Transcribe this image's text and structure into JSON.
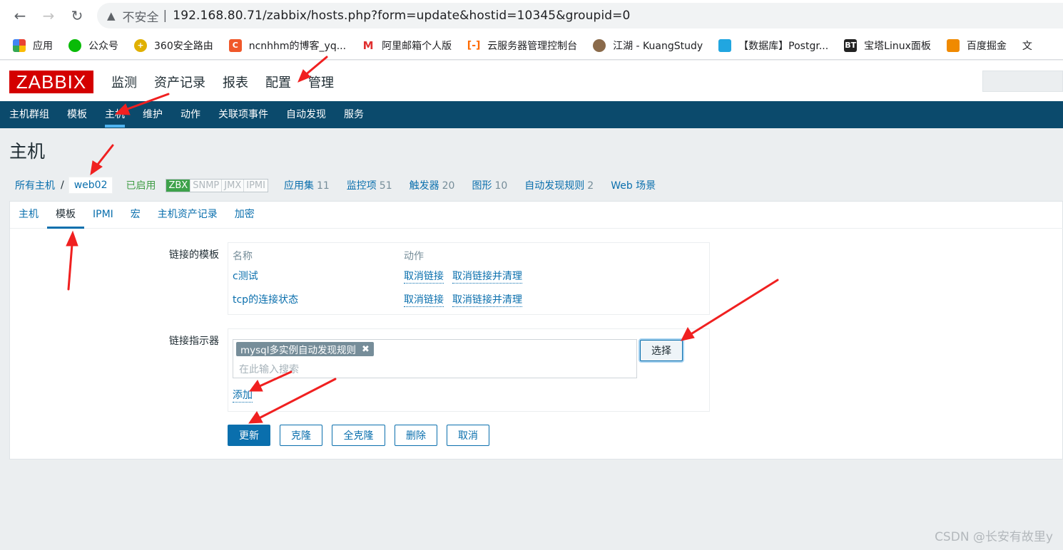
{
  "browser": {
    "insecure_label": "不安全",
    "separator": "|",
    "url": "192.168.80.71/zabbix/hosts.php?form=update&hostid=10345&groupid=0",
    "bookmarks": [
      {
        "label": "应用",
        "color": "#e94235"
      },
      {
        "label": "公众号",
        "color": "#09bb07"
      },
      {
        "label": "360安全路由",
        "color": "#e0b000"
      },
      {
        "label": "ncnhhm的博客_yq...",
        "color": "#f0582a"
      },
      {
        "label": "阿里邮箱个人版",
        "color": "#e03030"
      },
      {
        "label": "云服务器管理控制台",
        "color": "#ff6a00"
      },
      {
        "label": "江湖 - KuangStudy",
        "color": "#8a6a4a"
      },
      {
        "label": "【数据库】Postgr...",
        "color": "#21a6e0"
      },
      {
        "label": "宝塔Linux面板",
        "color": "#222222"
      },
      {
        "label": "百度掘金",
        "color": "#f08a00"
      }
    ],
    "bookmark_icon_texts": {
      "bt": "BT"
    },
    "overflow_char": "文"
  },
  "header": {
    "logo": "ZABBIX",
    "menu": [
      "监测",
      "资产记录",
      "报表",
      "配置",
      "管理"
    ]
  },
  "submenu": [
    "主机群组",
    "模板",
    "主机",
    "维护",
    "动作",
    "关联项事件",
    "自动发现",
    "服务"
  ],
  "page_title": "主机",
  "breadcrumb": {
    "all_hosts": "所有主机",
    "slash": "/",
    "current": "web02",
    "status": "已启用",
    "availability": [
      "ZBX",
      "SNMP",
      "JMX",
      "IPMI"
    ],
    "links": [
      {
        "label": "应用集",
        "count": "11"
      },
      {
        "label": "监控项",
        "count": "51"
      },
      {
        "label": "触发器",
        "count": "20"
      },
      {
        "label": "图形",
        "count": "10"
      },
      {
        "label": "自动发现规则",
        "count": "2"
      },
      {
        "label": "Web 场景",
        "count": ""
      }
    ]
  },
  "tabs": [
    "主机",
    "模板",
    "IPMI",
    "宏",
    "主机资产记录",
    "加密"
  ],
  "form": {
    "linked_templates_label": "链接的模板",
    "col_name": "名称",
    "col_action": "动作",
    "templates": [
      {
        "name": "c测试",
        "unlink": "取消链接",
        "unlink_clear": "取消链接并清理"
      },
      {
        "name": "tcp的连接状态",
        "unlink": "取消链接",
        "unlink_clear": "取消链接并清理"
      }
    ],
    "link_indicator_label": "链接指示器",
    "selected_chip": "mysql多实例自动发现规则",
    "chip_remove": "✖",
    "search_placeholder": "在此输入搜索",
    "select_button": "选择",
    "add_link": "添加"
  },
  "buttons": {
    "update": "更新",
    "clone": "克隆",
    "full_clone": "全克隆",
    "delete": "删除",
    "cancel": "取消"
  },
  "watermark": "CSDN @长安有故里y",
  "colors": {
    "accent": "#0a6fad",
    "nav_bg": "#0b4a6c",
    "logo_red": "#d40000",
    "enabled_green": "#429e47",
    "annotation_red": "#f02020"
  },
  "icons": [
    "back-arrow-icon",
    "forward-arrow-icon",
    "reload-icon",
    "warning-icon",
    "apps-grid-icon"
  ]
}
